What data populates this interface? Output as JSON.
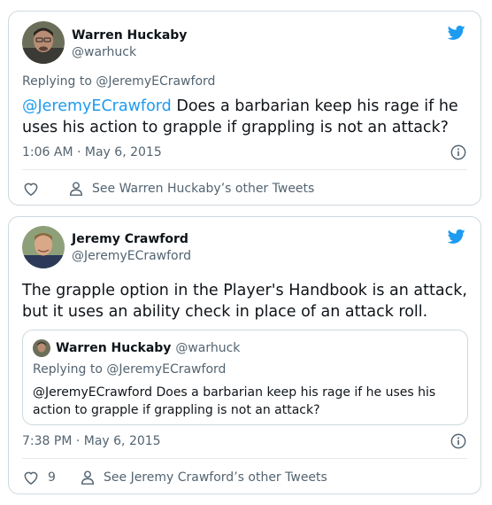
{
  "tweet1": {
    "author_name": "Warren Huckaby",
    "author_handle": "@warhuck",
    "replying_to": "Replying to @JeremyECrawford",
    "mention": "@JeremyECrawford",
    "text": " Does a barbarian keep his rage if he uses his action to grapple if grappling is not an attack?",
    "timestamp": "1:06 AM · May 6, 2015",
    "see_other": "See Warren Huckaby’s other Tweets"
  },
  "tweet2": {
    "author_name": "Jeremy Crawford",
    "author_handle": "@JeremyECrawford",
    "text": "The grapple option in the Player's Handbook is an attack, but it uses an ability check in place of an attack roll.",
    "quote": {
      "author_name": "Warren Huckaby",
      "author_handle": "@warhuck",
      "replying_to": "Replying to @JeremyECrawford",
      "text": "@JeremyECrawford Does a barbarian keep his rage if he uses his action to grapple if grappling is not an attack?"
    },
    "timestamp": "7:38 PM · May 6, 2015",
    "likes": "9",
    "see_other": "See Jeremy Crawford’s other Tweets"
  },
  "colors": {
    "accent": "#1d9bf0",
    "secondary_text": "#536471",
    "border": "#cfd9de"
  },
  "icons": [
    "twitter-bird-icon",
    "info-icon",
    "heart-icon",
    "person-icon"
  ]
}
